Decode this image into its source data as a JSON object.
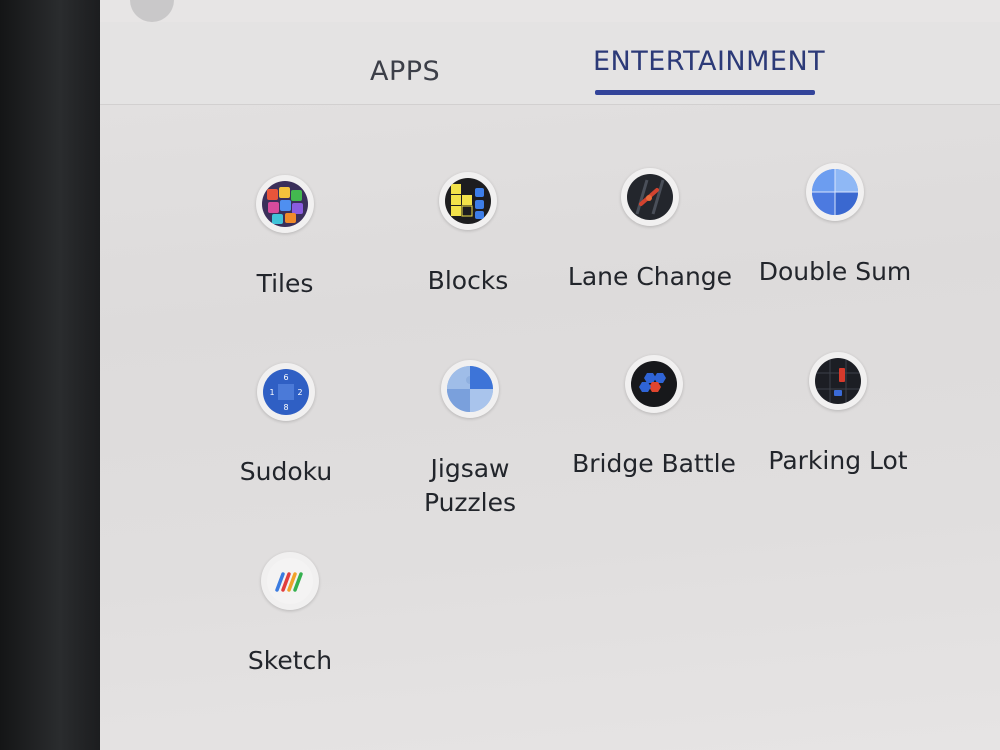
{
  "tabs": {
    "apps": "APPS",
    "entertainment": "ENTERTAINMENT",
    "active": "ENTERTAINMENT"
  },
  "accent_color": "#33449a",
  "apps": [
    {
      "label": "Tiles",
      "icon": "tiles-icon"
    },
    {
      "label": "Blocks",
      "icon": "blocks-icon"
    },
    {
      "label": "Lane Change",
      "icon": "lane-change-icon"
    },
    {
      "label": "Double Sum",
      "icon": "double-sum-icon"
    },
    {
      "label": "Sudoku",
      "icon": "sudoku-icon"
    },
    {
      "label": "Jigsaw Puzzles",
      "icon": "jigsaw-icon"
    },
    {
      "label": "Bridge Battle",
      "icon": "bridge-battle-icon"
    },
    {
      "label": "Parking Lot",
      "icon": "parking-lot-icon"
    },
    {
      "label": "Sketch",
      "icon": "sketch-icon"
    }
  ]
}
